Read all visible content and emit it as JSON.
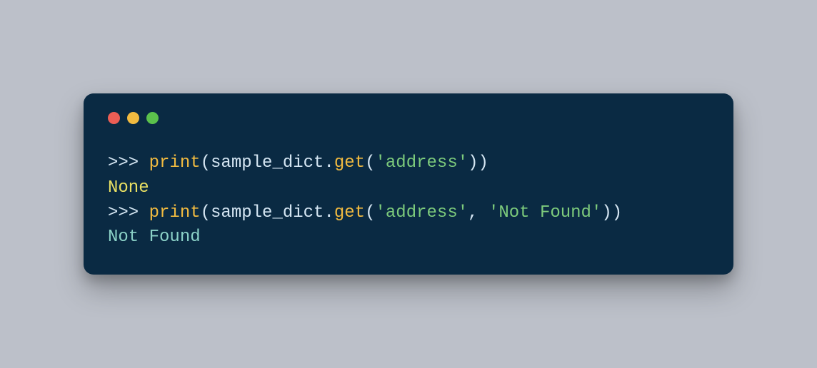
{
  "colors": {
    "background": "#bcc0c9",
    "window": "#0a2a43",
    "dot_red": "#ec5e55",
    "dot_yellow": "#f2bb40",
    "dot_green": "#5bc14c"
  },
  "code": {
    "line1": {
      "prompt": ">>> ",
      "func": "print",
      "open": "(",
      "ident": "sample_dict",
      "dot": ".",
      "method": "get",
      "open2": "(",
      "str": "'address'",
      "close": "))"
    },
    "line2": {
      "value": "None"
    },
    "line3": {
      "prompt": ">>> ",
      "func": "print",
      "open": "(",
      "ident": "sample_dict",
      "dot": ".",
      "method": "get",
      "open2": "(",
      "str1": "'address'",
      "comma": ", ",
      "str2": "'Not Found'",
      "close": "))"
    },
    "line4": {
      "value": "Not Found"
    }
  }
}
